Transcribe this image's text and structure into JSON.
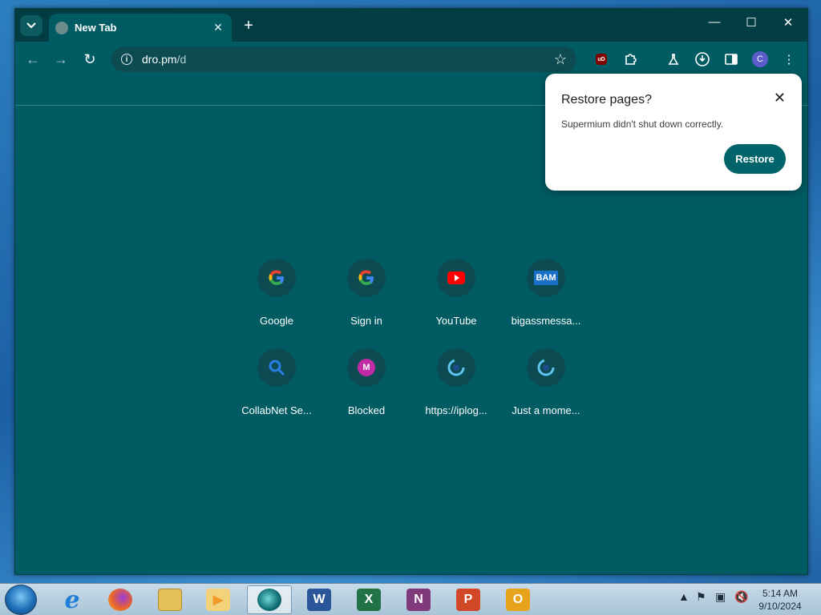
{
  "window": {
    "tab_title": "New Tab",
    "controls": {
      "minimize": "—",
      "maximize": "☐",
      "close": "✕"
    }
  },
  "toolbar": {
    "url_host": "dro.pm",
    "url_path": "/d",
    "profile_initial": "C",
    "ublock_label": "uD"
  },
  "restore_popup": {
    "title": "Restore pages?",
    "message": "Supermium didn't shut down correctly.",
    "button": "Restore"
  },
  "shortcuts": [
    {
      "label": "Google",
      "icon": "google-icon"
    },
    {
      "label": "Sign in",
      "icon": "google-icon"
    },
    {
      "label": "YouTube",
      "icon": "youtube-icon"
    },
    {
      "label": "bigassmessa...",
      "icon": "bam-icon",
      "icon_text": "BAM"
    },
    {
      "label": "CollabNet Se...",
      "icon": "magnifier-icon"
    },
    {
      "label": "Blocked",
      "icon": "m-icon",
      "icon_text": "M"
    },
    {
      "label": "https://iplog...",
      "icon": "loading-ring-icon"
    },
    {
      "label": "Just a mome...",
      "icon": "loading-ring-icon"
    }
  ],
  "taskbar": {
    "apps": [
      {
        "name": "internet-explorer",
        "glyph": "e",
        "color": "#1f7fd6"
      },
      {
        "name": "firefox",
        "glyph": "",
        "color": "#e8642c"
      },
      {
        "name": "file-explorer",
        "glyph": "",
        "color": "#e6c15a"
      },
      {
        "name": "media-player",
        "glyph": "▶",
        "color": "#f09a2a"
      },
      {
        "name": "supermium",
        "glyph": "",
        "color": "#0e6d73"
      },
      {
        "name": "word",
        "glyph": "W",
        "color": "#2b579a"
      },
      {
        "name": "excel",
        "glyph": "X",
        "color": "#217346"
      },
      {
        "name": "onenote",
        "glyph": "N",
        "color": "#80397b"
      },
      {
        "name": "powerpoint",
        "glyph": "P",
        "color": "#d24726"
      },
      {
        "name": "outlook",
        "glyph": "O",
        "color": "#e8a31c"
      }
    ],
    "time": "5:14 AM",
    "date": "9/10/2024"
  },
  "colors": {
    "browser_bg": "#015b63",
    "tabstrip_bg": "#023d43",
    "accent_button": "#01646b"
  }
}
